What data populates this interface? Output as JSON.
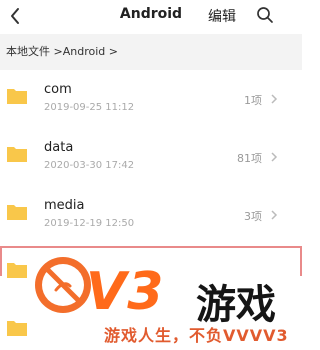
{
  "header": {
    "title": "Android",
    "edit_label": "编辑"
  },
  "breadcrumb": {
    "path": "本地文件 >Android >"
  },
  "items": [
    {
      "name": "com",
      "date": "2019-09-25 11:12",
      "count": "1项"
    },
    {
      "name": "data",
      "date": "2020-03-30 17:42",
      "count": "81项"
    },
    {
      "name": "media",
      "date": "2019-12-19 12:50",
      "count": "3项"
    },
    {
      "name": "",
      "date": "",
      "count": ""
    }
  ],
  "watermark": {
    "brand": "V3",
    "brand_cn": "游戏",
    "slogan": "游戏人生，不负VVVV3"
  },
  "colors": {
    "folder": "#f9c74a",
    "watermark_orange": "#ff6a1a",
    "highlight_border": "#e98a8a"
  },
  "icons": {
    "back": "back-icon",
    "search": "search-icon",
    "folder": "folder-icon",
    "chevron": "chevron-right-icon"
  }
}
